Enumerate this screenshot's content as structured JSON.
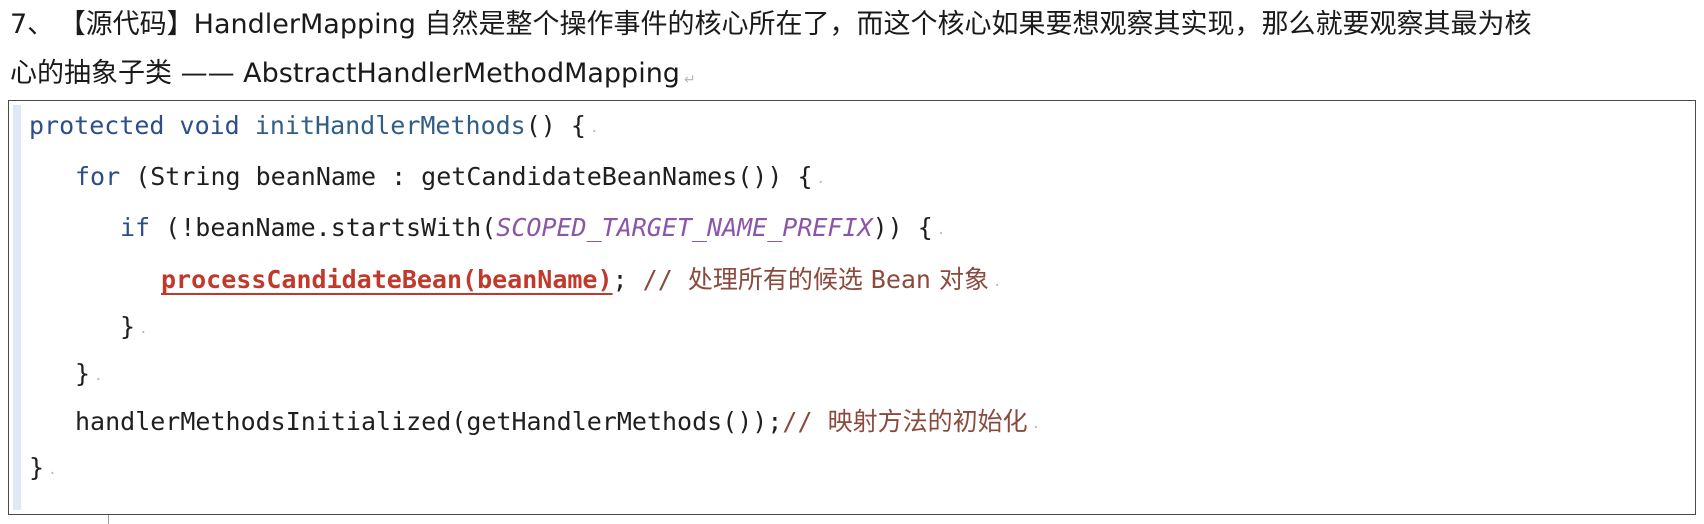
{
  "heading": {
    "number": "7、",
    "line1": "【源代码】HandlerMapping 自然是整个操作事件的核心所在了，而这个核心如果要想观察其实现，那么就要观察其最为核",
    "line2": "心的抽象子类 —— AbstractHandlerMethodMapping"
  },
  "code": {
    "l1_kw1": "protected",
    "l1_kw2": "void",
    "l1_fn": "initHandlerMethods",
    "l1_rest": "() {",
    "l2_kw": "for",
    "l2_rest": " (String beanName : getCandidateBeanNames()) {",
    "l3_kw": "if",
    "l3_a": " (!beanName.startsWith(",
    "l3_const": "SCOPED_TARGET_NAME_PREFIX",
    "l3_b": ")) {",
    "l4_call": "processCandidateBean(beanName)",
    "l4_semi": ";",
    "l4_comment_prefix": " // ",
    "l4_comment_cjk": "处理所有的候选 ",
    "l4_comment_mono": "Bean",
    "l4_comment_cjk2": " 对象",
    "l5": "}",
    "l6": "}",
    "l7_code": "handlerMethodsInitialized(getHandlerMethods());",
    "l7_comment_prefix": "// ",
    "l7_comment_cjk": "映射方法的初始化",
    "l8": "}"
  }
}
